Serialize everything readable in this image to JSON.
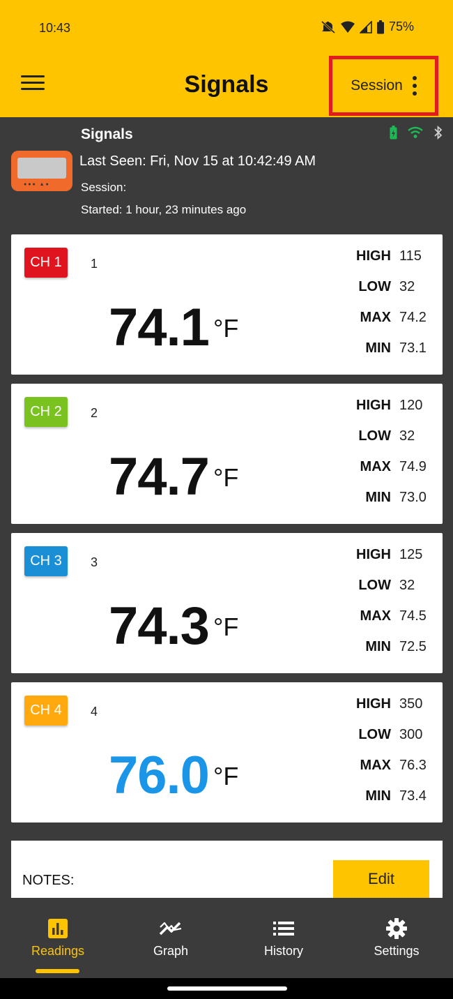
{
  "status": {
    "time": "10:43",
    "battery": "75%"
  },
  "appbar": {
    "title": "Signals",
    "session_label": "Session"
  },
  "device": {
    "name": "Signals",
    "last_seen": "Last Seen:  Fri, Nov 15  at 10:42:49 AM",
    "session": "Session:",
    "started": "Started: 1 hour, 23 minutes ago"
  },
  "stat_labels": {
    "high": "HIGH",
    "low": "LOW",
    "max": "MAX",
    "min": "MIN"
  },
  "channels": [
    {
      "badge": "CH 1",
      "color": "#e0141e",
      "name": "1",
      "temp": "74.1",
      "unit": "°F",
      "temp_color": "#111111",
      "high": "115",
      "low": "32",
      "max": "74.2",
      "min": "73.1"
    },
    {
      "badge": "CH 2",
      "color": "#7ac21f",
      "name": "2",
      "temp": "74.7",
      "unit": "°F",
      "temp_color": "#111111",
      "high": "120",
      "low": "32",
      "max": "74.9",
      "min": "73.0"
    },
    {
      "badge": "CH 3",
      "color": "#1b8fd6",
      "name": "3",
      "temp": "74.3",
      "unit": "°F",
      "temp_color": "#111111",
      "high": "125",
      "low": "32",
      "max": "74.5",
      "min": "72.5"
    },
    {
      "badge": "CH 4",
      "color": "#ffa90f",
      "name": "4",
      "temp": "76.0",
      "unit": "°F",
      "temp_color": "#1a95e8",
      "high": "350",
      "low": "300",
      "max": "76.3",
      "min": "73.4"
    }
  ],
  "notes": {
    "label": "NOTES:",
    "edit_label": "Edit"
  },
  "nav": [
    {
      "label": "Readings",
      "icon": "bar-chart-icon"
    },
    {
      "label": "Graph",
      "icon": "trend-icon"
    },
    {
      "label": "History",
      "icon": "list-icon"
    },
    {
      "label": "Settings",
      "icon": "gear-icon"
    }
  ],
  "colors": {
    "accent": "#ffc400",
    "background": "#3b3b3b",
    "session_highlight": "#e21c1c"
  }
}
